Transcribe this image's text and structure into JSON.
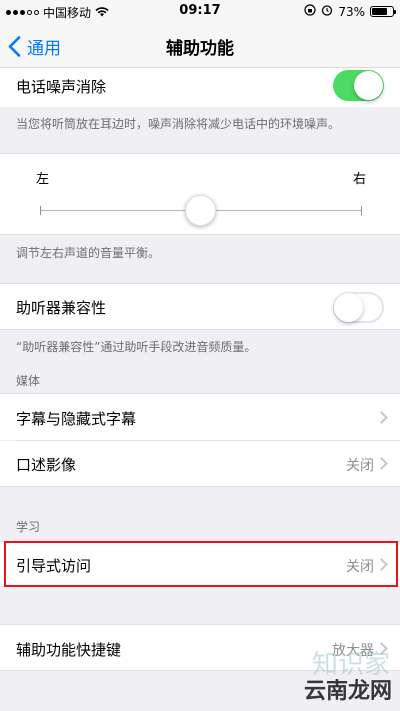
{
  "status_bar": {
    "carrier": "中国移动",
    "time": "09:17",
    "battery": "73%",
    "battery_level": 0.73
  },
  "nav": {
    "back_label": "通用",
    "title": "辅助功能"
  },
  "noise_cancel": {
    "label": "电话噪声消除",
    "enabled": true,
    "footnote": "当您将听筒放在耳边时，噪声消除将减少电话中的环境噪声。"
  },
  "balance": {
    "left_label": "左",
    "right_label": "右",
    "value": 0.5,
    "footnote": "调节左右声道的音量平衡。"
  },
  "hearing_aid": {
    "label": "助听器兼容性",
    "enabled": false,
    "footnote": "“助听器兼容性”通过助听手段改进音频质量。"
  },
  "media": {
    "header": "媒体",
    "items": [
      {
        "label": "字幕与隐藏式字幕",
        "value": ""
      },
      {
        "label": "口述影像",
        "value": "关闭"
      }
    ]
  },
  "learning": {
    "header": "学习",
    "items": [
      {
        "label": "引导式访问",
        "value": "关闭"
      }
    ]
  },
  "shortcut": {
    "label": "辅助功能快捷键",
    "value": "放大器"
  },
  "watermark": {
    "text": "云南龙网",
    "logo_text": "知识家"
  },
  "colors": {
    "accent": "#007aff",
    "toggle_on": "#4cd964",
    "highlight_box": "#e8141b"
  }
}
